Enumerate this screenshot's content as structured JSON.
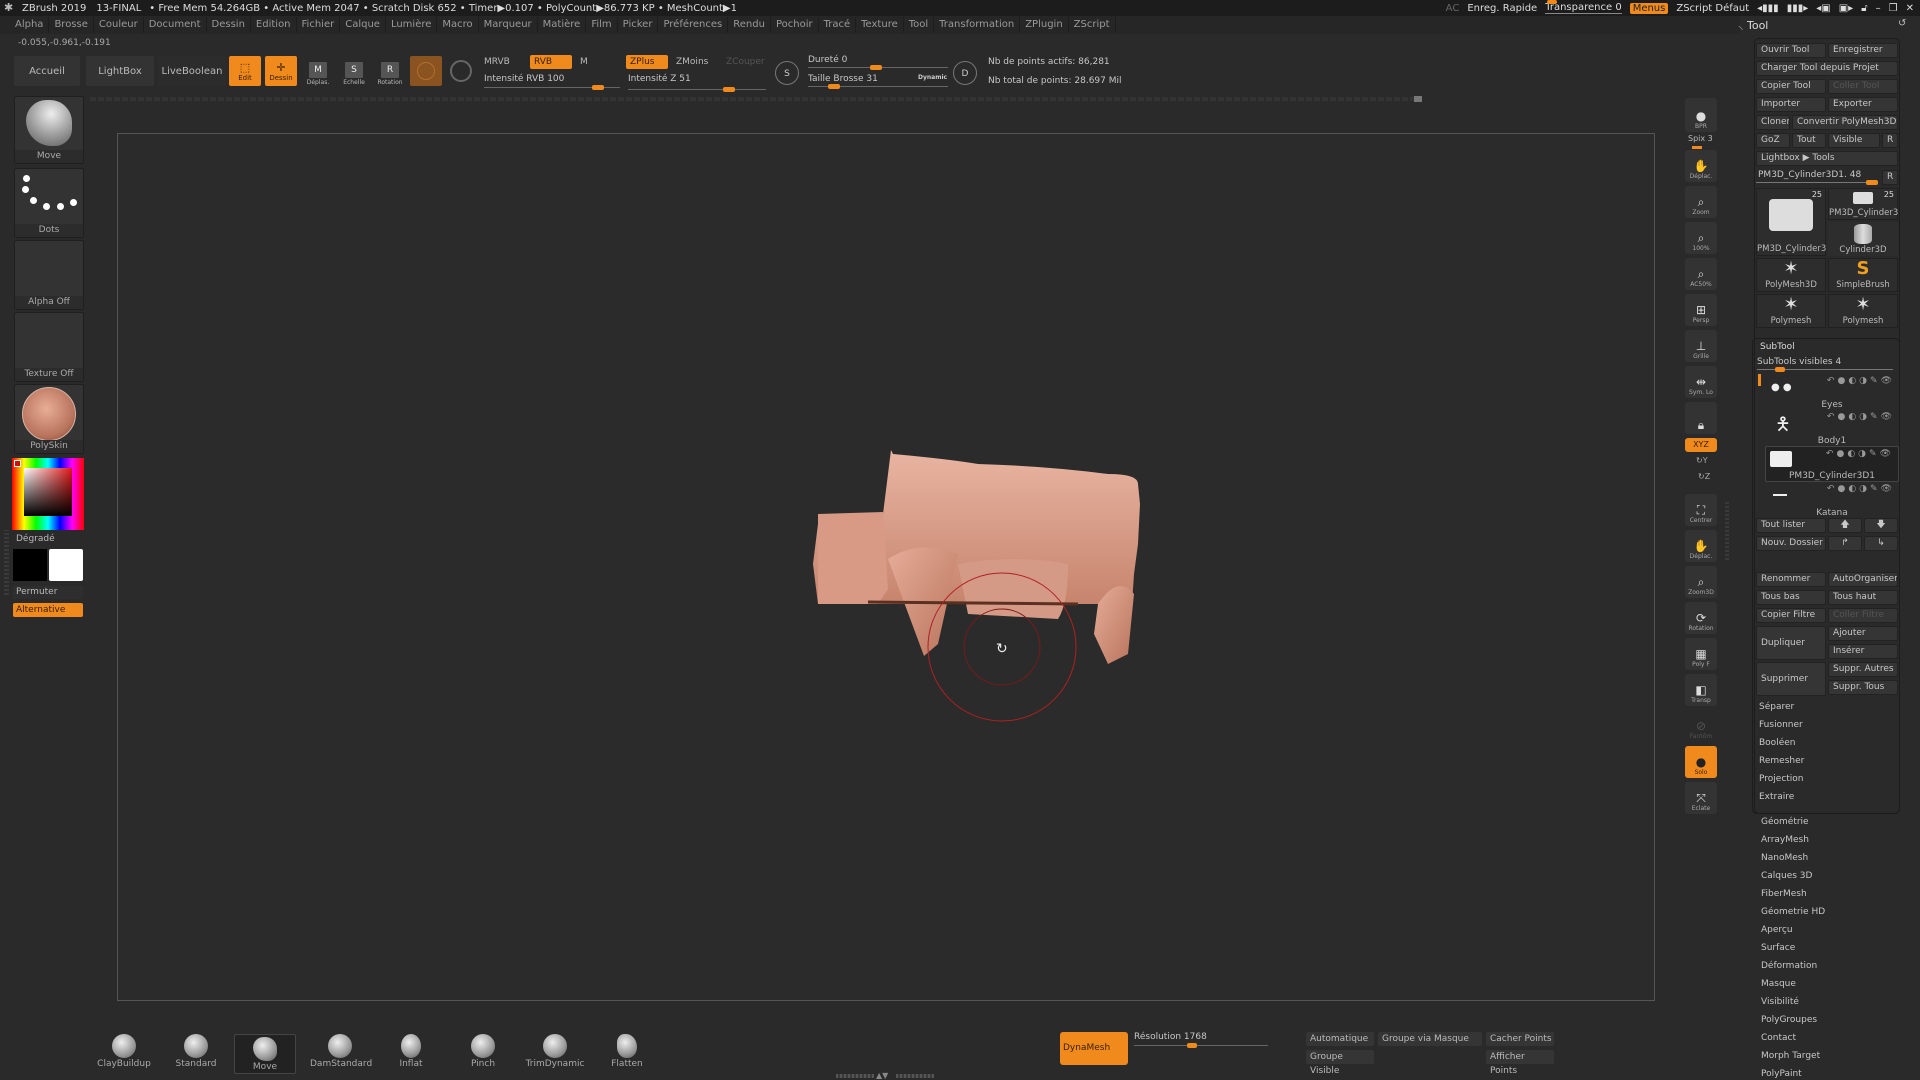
{
  "titlebar": {
    "app": "ZBrush 2019",
    "doc": "13-FINAL",
    "status": "• Free Mem 54.264GB • Active Mem 2047 • Scratch Disk 652 • Timer▶0.107 • PolyCount▶86.773 KP • MeshCount▶1",
    "ac": "AC",
    "quicksave": "Enreg. Rapide",
    "transparency": "Transparence 0",
    "menus": "Menus",
    "zscript": "ZScript Défaut"
  },
  "menubar": [
    "Alpha",
    "Brosse",
    "Couleur",
    "Document",
    "Dessin",
    "Edition",
    "Fichier",
    "Calque",
    "Lumière",
    "Macro",
    "Marqueur",
    "Matière",
    "Film",
    "Picker",
    "Préférences",
    "Rendu",
    "Pochoir",
    "Tracé",
    "Texture",
    "Tool",
    "Transformation",
    "ZPlugin",
    "ZScript"
  ],
  "coords": "-0.055,-0.961,-0.191",
  "top": {
    "home": "Accueil",
    "lightbox": "LightBox",
    "liveboolean": "LiveBoolean",
    "edit": "Edit",
    "draw": "Dessin",
    "move": "Déplas.",
    "scale": "Echelle",
    "rotate": "Rotation",
    "mrgb": "MRVB",
    "rgb": "RVB",
    "m": "M",
    "zadd": "ZPlus",
    "zsub": "ZMoins",
    "zcut": "ZCouper",
    "rgb_intensity": "Intensité RVB 100",
    "rgb_intensity_value": 100,
    "z_intensity": "Intensité Z 51",
    "z_intensity_value": 51,
    "hardness": "Dureté 0",
    "brush_size": "Taille Brosse 31",
    "dynamic": "Dynamic",
    "s": "S",
    "d": "D",
    "active_points": "Nb de points actifs: 86,281",
    "total_points": "Nb total de points: 28.697 Mil"
  },
  "left": {
    "brush": "Move",
    "stroke": "Dots",
    "alpha": "Alpha Off",
    "texture": "Texture Off",
    "material": "PolySkin",
    "gradient": "Dégradé",
    "swap": "Permuter",
    "alternate": "Alternative"
  },
  "right_tools": [
    {
      "label": "BPR",
      "icon": "bpr-icon"
    },
    {
      "label": "Spix 3",
      "icon": "spix-slider"
    },
    {
      "label": "Déplac.",
      "icon": "move-hand-icon"
    },
    {
      "label": "Zoom",
      "icon": "zoom-icon"
    },
    {
      "label": "100%",
      "icon": "zoom-100-icon"
    },
    {
      "label": "AC50%",
      "icon": "ac50-icon"
    },
    {
      "label": "Persp",
      "icon": "perspective-icon"
    },
    {
      "label": "Grille",
      "icon": "floor-grid-icon"
    },
    {
      "label": "Sym. Lo",
      "icon": "local-symmetry-icon"
    },
    {
      "label": "",
      "icon": "lock-camera-icon"
    },
    {
      "label": "XYZ",
      "icon": "rotate-xyz-icon"
    },
    {
      "label": "Y",
      "icon": "rotate-y-icon"
    },
    {
      "label": "Z",
      "icon": "rotate-z-icon"
    },
    {
      "label": "Centrer",
      "icon": "frame-icon"
    },
    {
      "label": "Déplac.",
      "icon": "move3d-icon"
    },
    {
      "label": "Zoom3D",
      "icon": "zoom3d-icon"
    },
    {
      "label": "Rotation",
      "icon": "rotate3d-icon"
    },
    {
      "label": "Poly F",
      "icon": "polyframe-icon"
    },
    {
      "label": "Transp",
      "icon": "transparency-icon"
    },
    {
      "label": "Fantôm",
      "icon": "ghost-icon"
    },
    {
      "label": "Solo",
      "icon": "solo-icon"
    },
    {
      "label": "Eclate",
      "icon": "explode-icon"
    }
  ],
  "tool": {
    "title": "Tool",
    "open": "Ouvrir Tool",
    "save": "Enregistrer",
    "load_project": "Charger Tool depuis Projet",
    "copy": "Copier Tool",
    "paste": "Coller Tool",
    "import": "Importer",
    "export": "Exporter",
    "clone": "Cloner",
    "convert": "Convertir PolyMesh3D",
    "goz": "GoZ",
    "all": "Tout",
    "visible": "Visible",
    "r": "R",
    "lightbox_tools": "Lightbox ▶ Tools",
    "current": "PM3D_Cylinder3D1. 48",
    "thumbs": [
      {
        "name": "PM3D_Cylinder3",
        "count": "25"
      },
      {
        "name": "PM3D_Cylinder3",
        "count": "25"
      },
      {
        "name": "Cylinder3D",
        "count": ""
      },
      {
        "name": "PolyMesh3D",
        "count": ""
      },
      {
        "name": "SimpleBrush",
        "count": ""
      },
      {
        "name": "Polymesh",
        "count": ""
      },
      {
        "name": "Polymesh",
        "count": ""
      }
    ]
  },
  "subtool": {
    "title": "SubTool",
    "visible_count": "SubTools visibles 4",
    "items": [
      {
        "name": "Eyes",
        "selected": false
      },
      {
        "name": "Body1",
        "selected": false
      },
      {
        "name": "PM3D_Cylinder3D1",
        "selected": true
      },
      {
        "name": "Katana",
        "selected": false
      }
    ],
    "list_all": "Tout lister",
    "new_folder": "Nouv. Dossier",
    "rename": "Renommer",
    "autoreorder": "AutoOrganiser",
    "all_low": "Tous bas",
    "all_high": "Tous haut",
    "copy_filter": "Copier Filtre",
    "paste_filter": "Coller Filtre",
    "duplicate": "Dupliquer",
    "append": "Ajouter",
    "insert": "Insérer",
    "delete": "Supprimer",
    "del_other": "Suppr. Autres",
    "del_all": "Suppr. Tous",
    "sections": [
      "Séparer",
      "Fusionner",
      "Booléen",
      "Remesher",
      "Projection",
      "Extraire"
    ]
  },
  "tool_menus": [
    "Géométrie",
    "ArrayMesh",
    "NanoMesh",
    "Calques 3D",
    "FiberMesh",
    "Géometrie HD",
    "Aperçu",
    "Surface",
    "Déformation",
    "Masque",
    "Visibilité",
    "PolyGroupes",
    "Contact",
    "Morph Target",
    "PolyPaint"
  ],
  "bottom": {
    "brushes": [
      "ClayBuildup",
      "Standard",
      "Move",
      "DamStandard",
      "Inflat",
      "Pinch",
      "TrimDynamic",
      "Flatten"
    ],
    "selected_brush": "Move",
    "dynamesh": "DynaMesh",
    "resolution": "Résolution 1768",
    "auto": "Automatique",
    "group_mask": "Groupe via Masque",
    "group_visible": "Groupe Visible",
    "hide_points": "Cacher Points",
    "show_points": "Afficher Points"
  },
  "colors": {
    "accent": "#f08a1c",
    "bg": "#2a2a2a",
    "mesh": "#d59a86",
    "brush_ring": "#b02020"
  }
}
